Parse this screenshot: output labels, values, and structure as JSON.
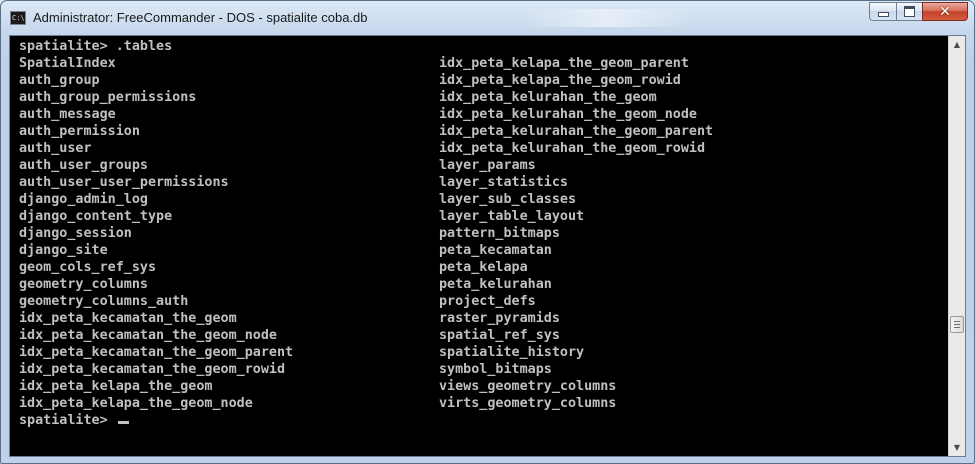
{
  "window": {
    "title": "Administrator: FreeCommander - DOS - spatialite  coba.db",
    "icon": "cmd-icon",
    "icon_text": "C:\\"
  },
  "caption_buttons": {
    "close_glyph": "✕"
  },
  "console": {
    "prompt_command": "spatialite> .tables",
    "final_prompt": "spatialite> ",
    "left_column": [
      "SpatialIndex",
      "auth_group",
      "auth_group_permissions",
      "auth_message",
      "auth_permission",
      "auth_user",
      "auth_user_groups",
      "auth_user_user_permissions",
      "django_admin_log",
      "django_content_type",
      "django_session",
      "django_site",
      "geom_cols_ref_sys",
      "geometry_columns",
      "geometry_columns_auth",
      "idx_peta_kecamatan_the_geom",
      "idx_peta_kecamatan_the_geom_node",
      "idx_peta_kecamatan_the_geom_parent",
      "idx_peta_kecamatan_the_geom_rowid",
      "idx_peta_kelapa_the_geom",
      "idx_peta_kelapa_the_geom_node"
    ],
    "right_column": [
      "idx_peta_kelapa_the_geom_parent",
      "idx_peta_kelapa_the_geom_rowid",
      "idx_peta_kelurahan_the_geom",
      "idx_peta_kelurahan_the_geom_node",
      "idx_peta_kelurahan_the_geom_parent",
      "idx_peta_kelurahan_the_geom_rowid",
      "layer_params",
      "layer_statistics",
      "layer_sub_classes",
      "layer_table_layout",
      "pattern_bitmaps",
      "peta_kecamatan",
      "peta_kelapa",
      "peta_kelurahan",
      "project_defs",
      "raster_pyramids",
      "spatial_ref_sys",
      "spatialite_history",
      "symbol_bitmaps",
      "views_geometry_columns",
      "virts_geometry_columns"
    ]
  },
  "scrollbar": {
    "position_fraction": 0.97,
    "up_glyph": "▲",
    "down_glyph": "▼"
  },
  "colors": {
    "console_bg": "#000000",
    "console_text": "#c0c0c0",
    "close_button": "#c4432b"
  }
}
